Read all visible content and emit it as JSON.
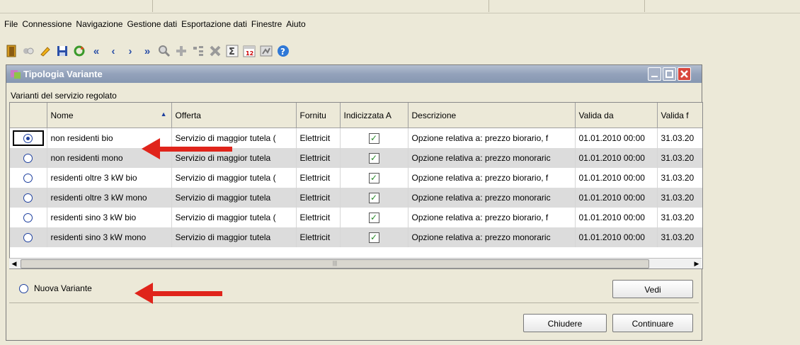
{
  "menu": [
    "File",
    "Connessione",
    "Navigazione",
    "Gestione dati",
    "Esportazione dati",
    "Finestre",
    "Aiuto"
  ],
  "toolbar_icons": [
    "exit-icon",
    "connect-icon",
    "edit-icon",
    "save-icon",
    "refresh-icon",
    "first-icon",
    "prev-icon",
    "next-icon",
    "last-icon",
    "search-icon",
    "add-icon",
    "tree-icon",
    "delete-icon",
    "sum-icon",
    "calendar-icon",
    "report-icon",
    "help-icon"
  ],
  "window": {
    "title": "Tipologia Variante",
    "subtitle": "Varianti del servizio regolato"
  },
  "table": {
    "columns": [
      "",
      "Nome",
      "Offerta",
      "Fornitu",
      "Indicizzata A",
      "Descrizione",
      "Valida da",
      "Valida f"
    ],
    "rows": [
      {
        "selected": true,
        "nome": "non residenti bio",
        "offerta": "Servizio di maggior tutela (",
        "fornitura": "Elettricit",
        "indicizzata": true,
        "descrizione": "Opzione relativa a: prezzo biorario, f",
        "valida_da": "01.01.2010 00:00",
        "valida_fino": "31.03.20"
      },
      {
        "selected": false,
        "nome": "non residenti mono",
        "offerta": "Servizio di maggior tutela",
        "fornitura": "Elettricit",
        "indicizzata": true,
        "descrizione": "Opzione relativa a: prezzo monoraric",
        "valida_da": "01.01.2010 00:00",
        "valida_fino": "31.03.20"
      },
      {
        "selected": false,
        "nome": "residenti oltre 3 kW bio",
        "offerta": "Servizio di maggior tutela (",
        "fornitura": "Elettricit",
        "indicizzata": true,
        "descrizione": "Opzione relativa a: prezzo biorario, f",
        "valida_da": "01.01.2010 00:00",
        "valida_fino": "31.03.20"
      },
      {
        "selected": false,
        "nome": "residenti oltre 3 kW mono",
        "offerta": "Servizio di maggior tutela",
        "fornitura": "Elettricit",
        "indicizzata": true,
        "descrizione": "Opzione relativa a: prezzo monoraric",
        "valida_da": "01.01.2010 00:00",
        "valida_fino": "31.03.20"
      },
      {
        "selected": false,
        "nome": "residenti sino 3 kW bio",
        "offerta": "Servizio di maggior tutela (",
        "fornitura": "Elettricit",
        "indicizzata": true,
        "descrizione": "Opzione relativa a: prezzo biorario, f",
        "valida_da": "01.01.2010 00:00",
        "valida_fino": "31.03.20"
      },
      {
        "selected": false,
        "nome": "residenti sino 3 kW mono",
        "offerta": "Servizio di maggior tutela",
        "fornitura": "Elettricit",
        "indicizzata": true,
        "descrizione": "Opzione relativa a: prezzo monoraric",
        "valida_da": "01.01.2010 00:00",
        "valida_fino": "31.03.20"
      }
    ]
  },
  "nuova_label": "Nuova Variante",
  "buttons": {
    "vedi": "Vedi",
    "chiudere": "Chiudere",
    "continuare": "Continuare"
  },
  "colors": {
    "annotation_arrow": "#e0241b",
    "titlebar": "#93a2bb",
    "radio": "#1d3f9e"
  }
}
